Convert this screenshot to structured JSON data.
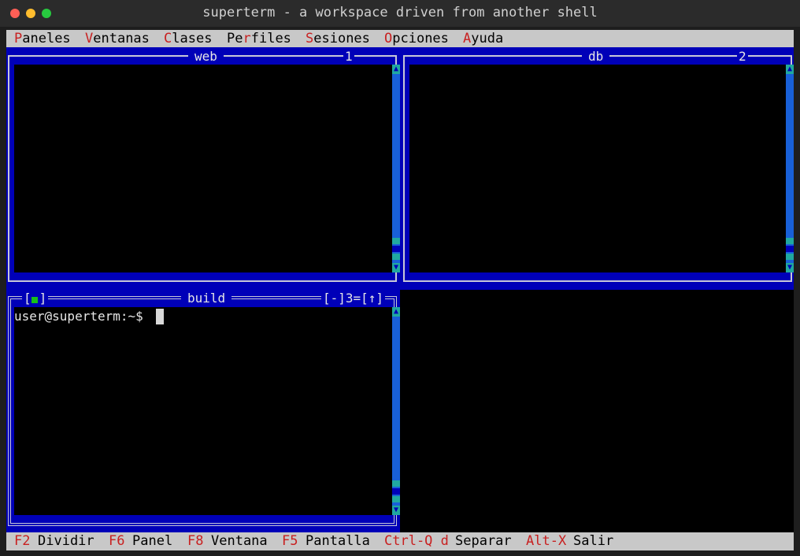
{
  "window": {
    "title": "superterm - a workspace driven from another shell"
  },
  "menubar": {
    "items": [
      {
        "hot": "P",
        "rest": "aneles"
      },
      {
        "hot": "V",
        "rest": "entanas"
      },
      {
        "hot": "C",
        "rest": "lases"
      },
      {
        "pre": "Pe",
        "hot": "r",
        "rest": "files"
      },
      {
        "hot": "S",
        "rest": "esiones"
      },
      {
        "hot": "O",
        "rest": "pciones"
      },
      {
        "hot": "A",
        "rest": "yuda"
      }
    ]
  },
  "panels": {
    "web": {
      "title": "web",
      "number": "1"
    },
    "db": {
      "title": "db",
      "number": "2"
    },
    "build": {
      "title": "build",
      "controls_left": "[",
      "controls_left_end": "]",
      "controls_right": "[-]3=[↑]",
      "prompt": "user@superterm:~$"
    }
  },
  "statusbar": {
    "items": [
      {
        "key": "F2",
        "label": "Dividir"
      },
      {
        "key": "F6",
        "label": "Panel"
      },
      {
        "key": "F8",
        "label": "Ventana"
      },
      {
        "key": "F5",
        "label": "Pantalla"
      },
      {
        "key": "Ctrl-Q d",
        "label": "Separar"
      },
      {
        "key": "Alt-X",
        "label": "Salir"
      }
    ]
  },
  "colors": {
    "panel_blue": "#0000b8",
    "hotkey_red": "#c82020",
    "scroll_teal": "#20a8a0",
    "bar_gray": "#c8c8c8"
  },
  "icons": [
    "close-icon",
    "minimize-icon",
    "maximize-icon",
    "scroll-up-arrow-icon",
    "scroll-down-arrow-icon",
    "active-window-indicator-icon"
  ]
}
